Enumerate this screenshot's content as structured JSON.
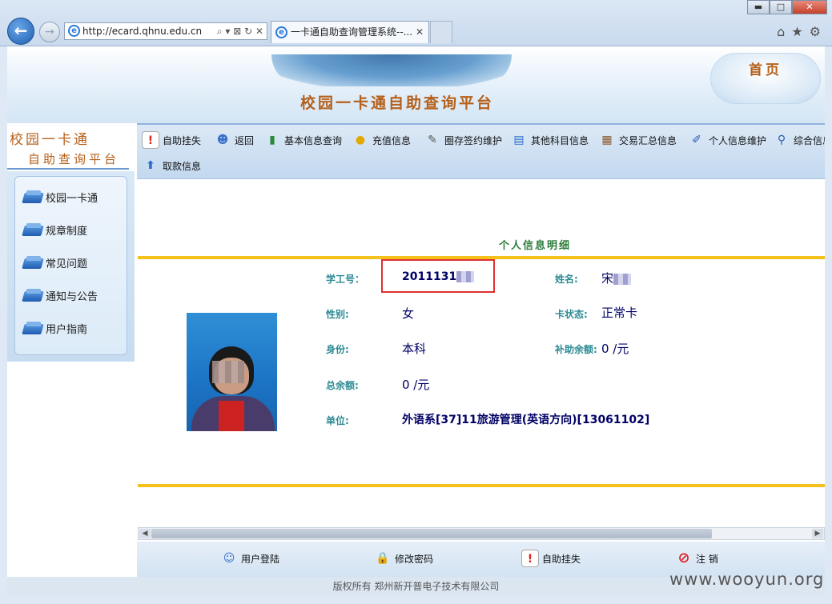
{
  "browser": {
    "url": "http://ecard.qhnu.edu.cn",
    "address_tools": "⌕ ▾ ⊠ ↻ ✕",
    "tab_title": "一卡通自助查询管理系统--...",
    "tab_close": "✕",
    "win_min": "▬",
    "win_max": "□",
    "win_close": "✕",
    "home_icon": "⌂",
    "star_icon": "★",
    "gear_icon": "⚙"
  },
  "banner": {
    "title": "校园一卡通自助查询平台",
    "home_link": "首页"
  },
  "sidebar": {
    "title_line1": "校园一卡通",
    "title_line2": "自助查询平台",
    "items": [
      "校园一卡通",
      "规章制度",
      "常见问题",
      "通知与公告",
      "用户指南"
    ]
  },
  "toolbar": {
    "items": [
      "自助挂失",
      "返回",
      "基本信息查询",
      "充值信息",
      "圈存签约维护",
      "其他科目信息",
      "交易汇总信息",
      "个人信息维护",
      "综合信息",
      "取款信息"
    ]
  },
  "detail": {
    "title": "个人信息明细",
    "student_id_label": "学工号：",
    "student_id_value": "2011131",
    "name_label": "姓名:",
    "name_value": "宋",
    "gender_label": "性别:",
    "gender_value": "女",
    "card_status_label": "卡状态:",
    "card_status_value": "正常卡",
    "identity_label": "身份:",
    "identity_value": "本科",
    "subsidy_label": "补助余额:",
    "subsidy_value": "0 /元",
    "total_label": "总余额:",
    "total_value": "0 /元",
    "unit_label": "单位:",
    "unit_value": "外语系[37]11旅游管理(英语方向)[13061102]"
  },
  "bottom_nav": [
    "用户登陆",
    "修改密码",
    "自助挂失",
    "注 销"
  ],
  "footer": "版权所有 郑州新开普电子技术有限公司",
  "watermark": "www.wooyun.org"
}
